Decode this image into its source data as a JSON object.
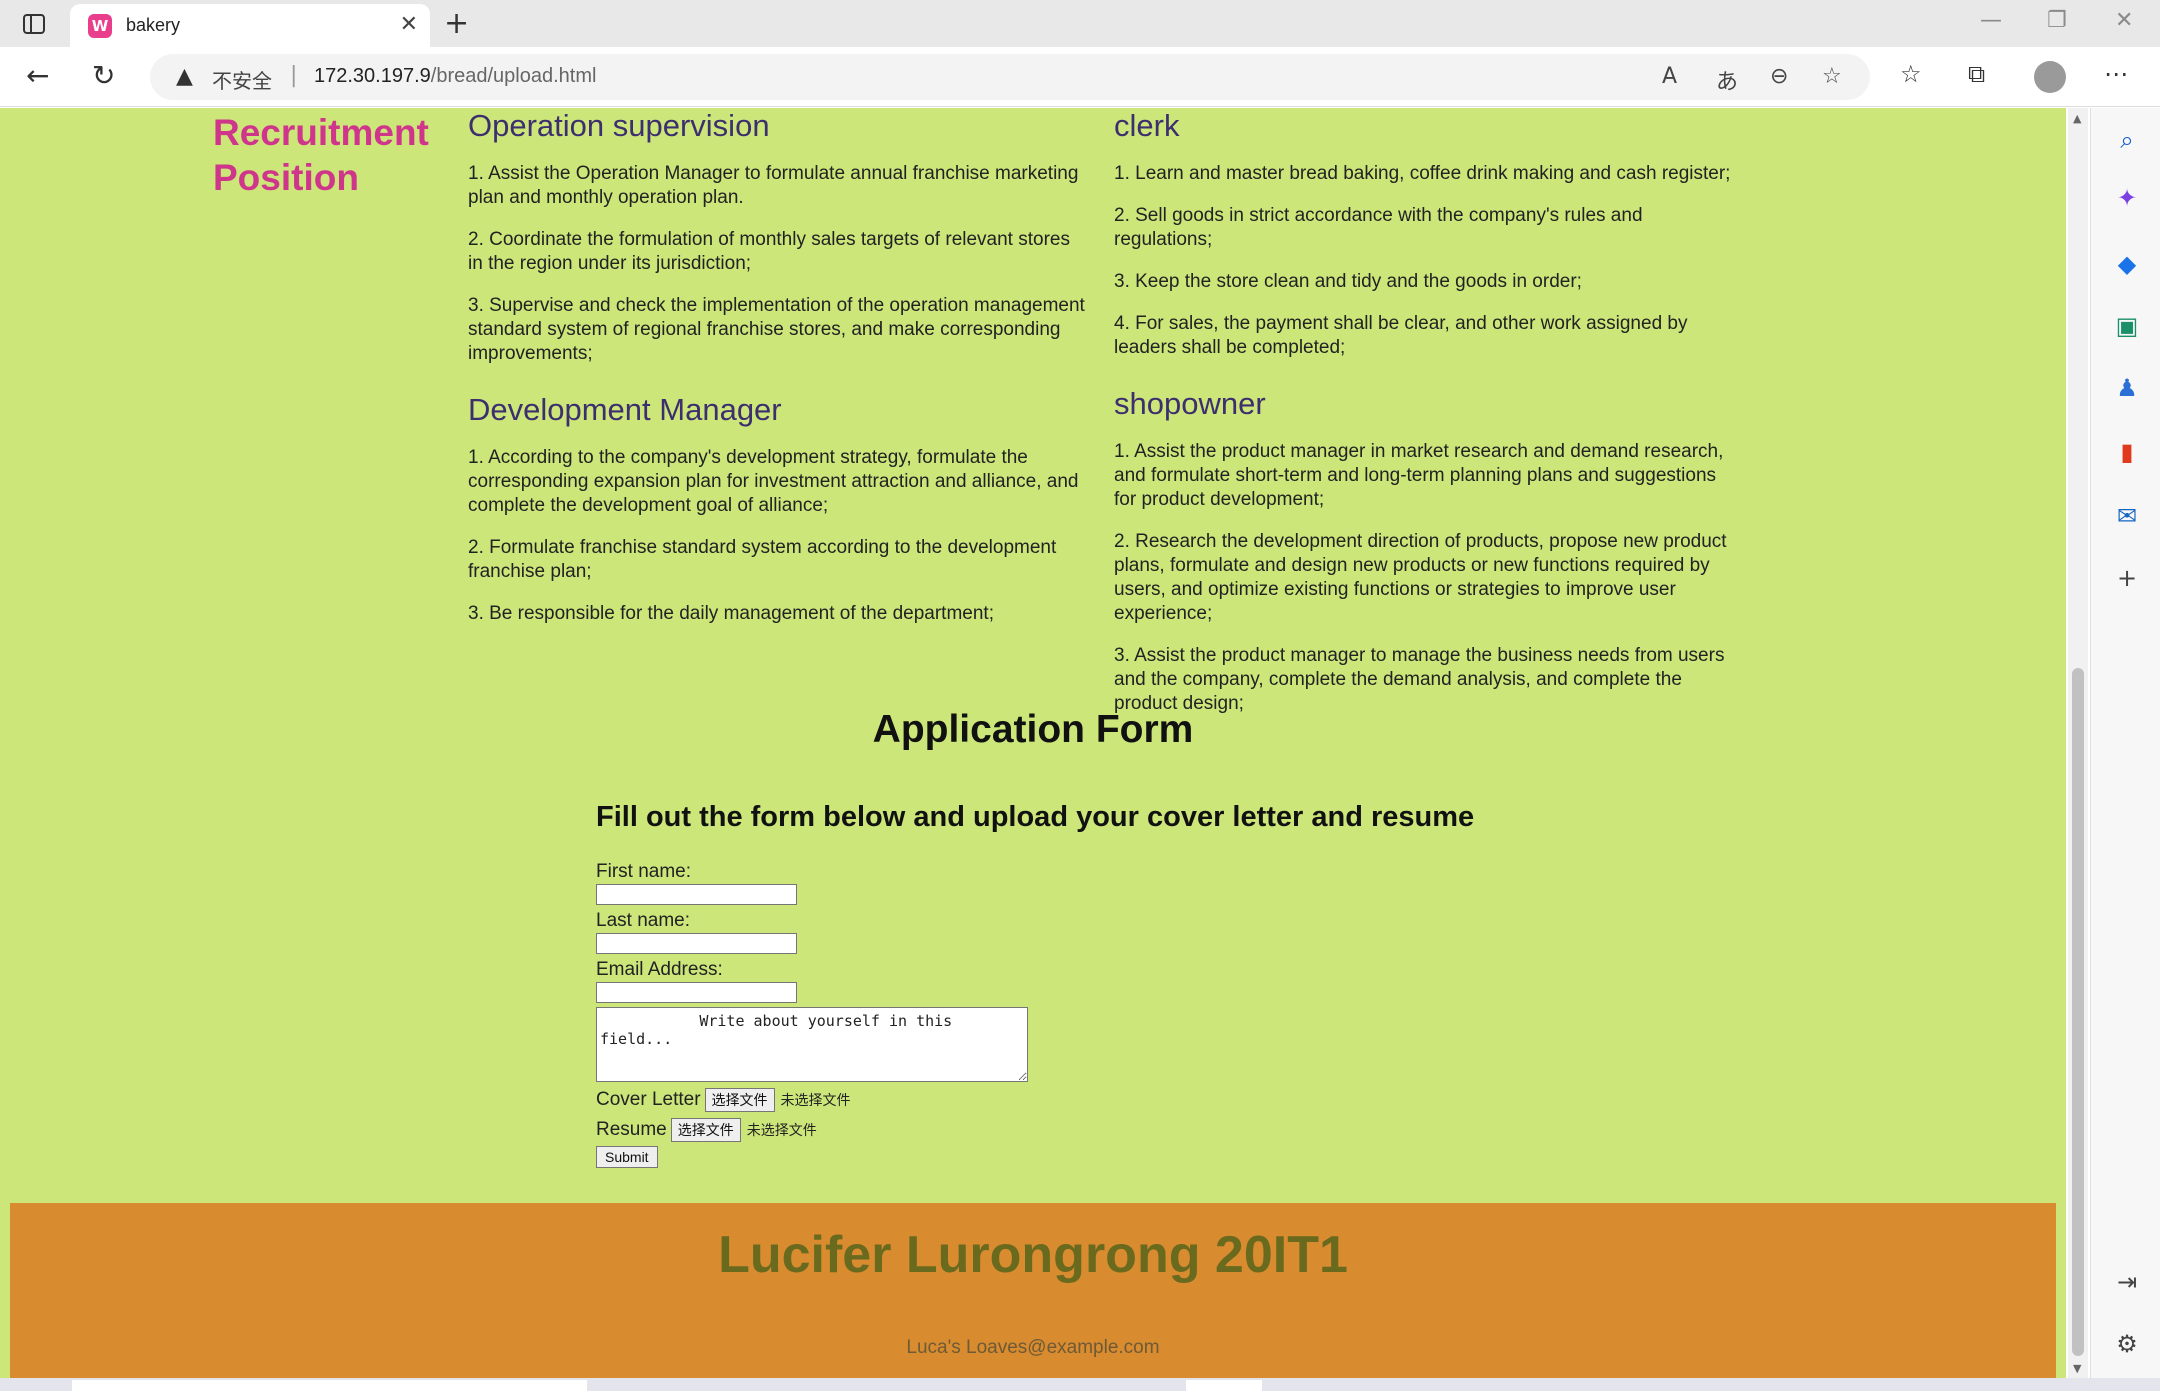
{
  "browser": {
    "tab_title": "bakery",
    "favicon_letter": "W",
    "insecure_label": "不安全",
    "url_host": "172.30.197.9",
    "url_path": "/bread/upload.html"
  },
  "page": {
    "recruitment_title": "Recruitment Position",
    "jobs_left": [
      {
        "title": "Operation supervision",
        "items": [
          "1. Assist the Operation Manager to formulate annual franchise marketing plan and monthly operation plan.",
          "2. Coordinate the formulation of monthly sales targets of relevant stores in the region under its jurisdiction;",
          "3. Supervise and check the implementation of the operation management standard system of regional franchise stores, and make corresponding improvements;"
        ]
      },
      {
        "title": "Development Manager",
        "items": [
          "1. According to the company's development strategy, formulate the corresponding expansion plan for investment attraction and alliance, and complete the development goal of alliance;",
          "2. Formulate franchise standard system according to the development franchise plan;",
          "3. Be responsible for the daily management of the department;"
        ]
      }
    ],
    "jobs_right": [
      {
        "title": "clerk",
        "items": [
          "1. Learn and master bread baking, coffee drink making and cash register;",
          "2. Sell goods in strict accordance with the company's rules and regulations;",
          "3. Keep the store clean and tidy and the goods in order;",
          "4. For sales, the payment shall be clear, and other work assigned by leaders shall be completed;"
        ]
      },
      {
        "title": "shopowner",
        "items": [
          "1. Assist the product manager in market research and demand research, and formulate short-term and long-term planning plans and suggestions for product development;",
          "2. Research the development direction of products, propose new product plans, formulate and design new products or new functions required by users, and optimize existing functions or strategies to improve user experience;",
          "3. Assist the product manager to manage the business needs from users and the company, complete the demand analysis, and complete the product design;"
        ]
      }
    ],
    "form": {
      "title": "Application Form",
      "subtitle": "Fill out the form below and upload your cover letter and resume",
      "first_name_label": "First name:",
      "last_name_label": "Last name:",
      "email_label": "Email Address:",
      "first_name_value": "",
      "last_name_value": "",
      "email_value": "",
      "about_text": "           Write about yourself in this field...",
      "cover_letter_label": "Cover Letter",
      "resume_label": "Resume",
      "choose_file": "选择文件",
      "no_file": "未选择文件",
      "submit": "Submit"
    },
    "footer": {
      "title": "Lucifer Lurongrong 20IT1",
      "email": "Luca's Loaves@example.com"
    }
  },
  "colors": {
    "page_bg": "#cce67a",
    "accent_pink": "#d0358c",
    "job_title": "#3d2f6e",
    "footer_bg": "#d98b30",
    "footer_text": "#6a6a1e"
  }
}
